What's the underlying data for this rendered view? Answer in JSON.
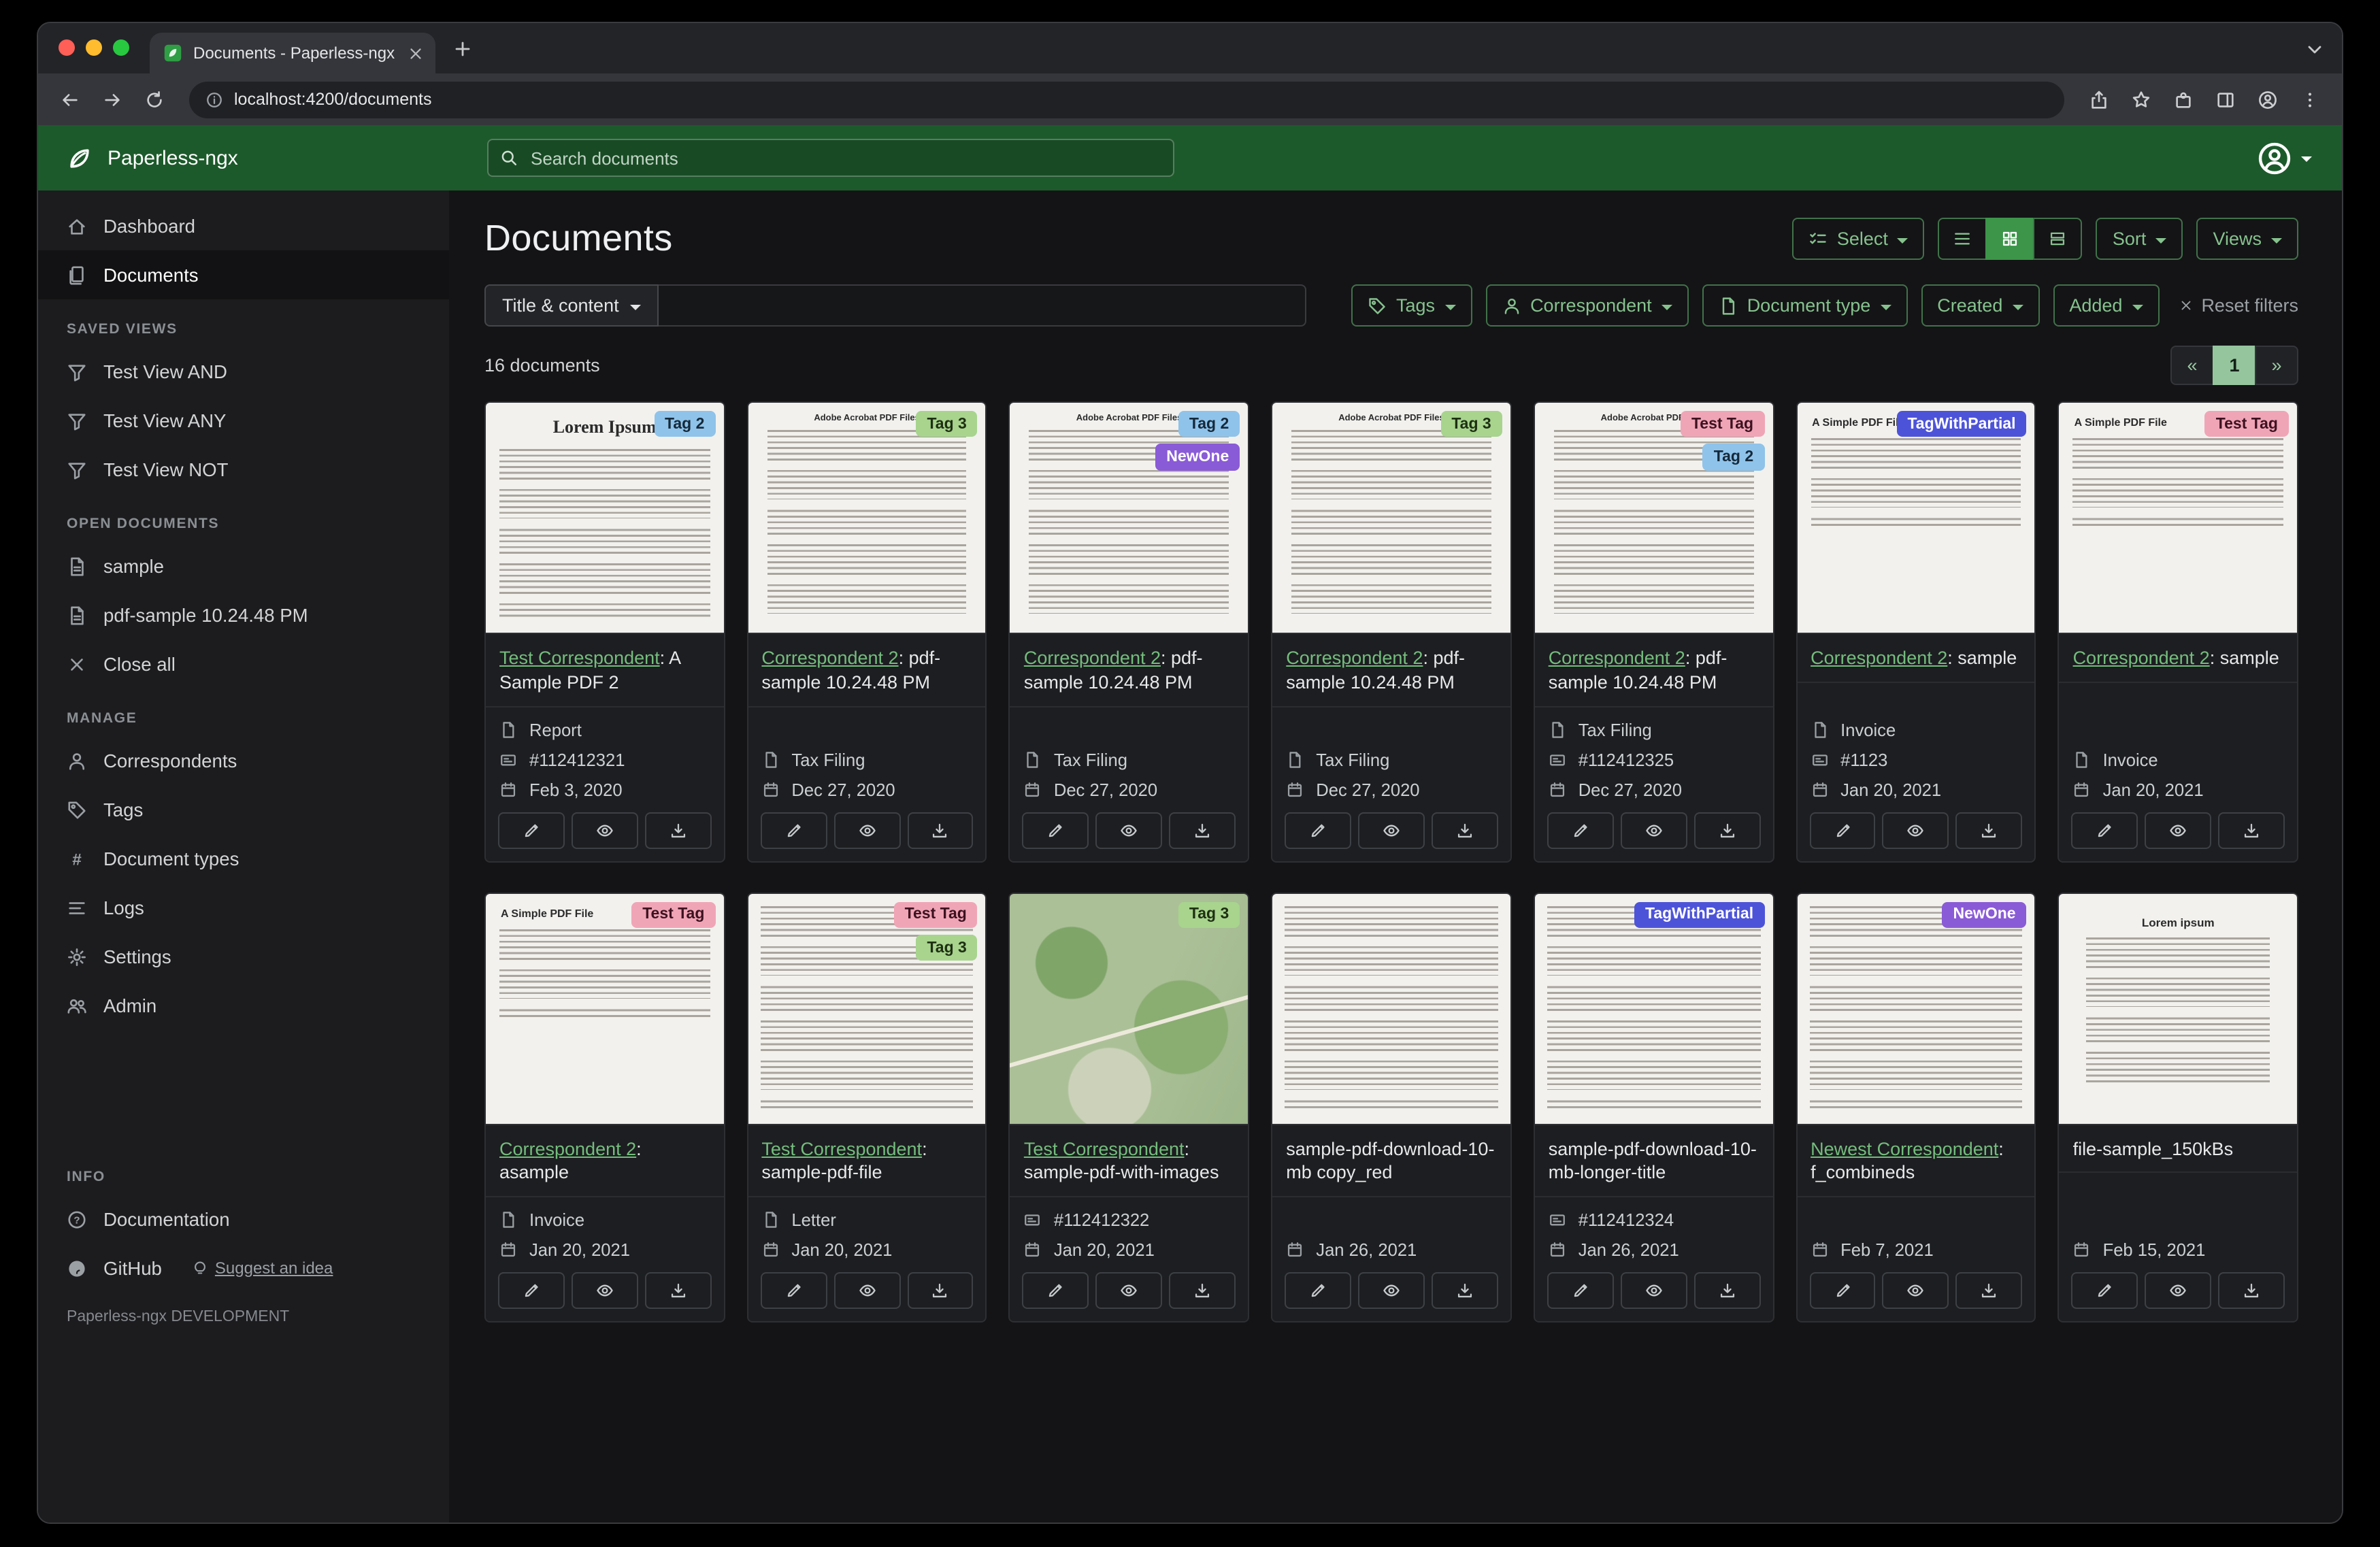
{
  "theme": {
    "accent": "#86c28e",
    "accent-border": "#41724a",
    "active-green": "#3c9549",
    "header-green": "#1d5a2b",
    "link-green": "#74bd7d",
    "page-bg": "#141416",
    "sidebar-bg": "#1c1c1f",
    "card-bg": "#1d1e21"
  },
  "browser": {
    "tab_title": "Documents - Paperless-ngx",
    "url": "localhost:4200/documents"
  },
  "header": {
    "brand": "Paperless-ngx",
    "search_placeholder": "Search documents"
  },
  "sidebar": {
    "dashboard": "Dashboard",
    "documents": "Documents",
    "saved_views_header": "SAVED VIEWS",
    "view_and": "Test View AND",
    "view_any": "Test View ANY",
    "view_not": "Test View NOT",
    "open_documents_header": "OPEN DOCUMENTS",
    "open_doc_1": "sample",
    "open_doc_2": "pdf-sample 10.24.48 PM",
    "close_all": "Close all",
    "manage_header": "MANAGE",
    "correspondents": "Correspondents",
    "tags": "Tags",
    "document_types": "Document types",
    "logs": "Logs",
    "settings": "Settings",
    "admin": "Admin",
    "info_header": "INFO",
    "documentation": "Documentation",
    "github": "GitHub",
    "suggest": "Suggest an idea",
    "footer": "Paperless-ngx DEVELOPMENT"
  },
  "toolbar": {
    "title": "Documents",
    "select_label": "Select",
    "sort_label": "Sort",
    "views_label": "Views"
  },
  "filters": {
    "field_label": "Title & content",
    "query_value": "",
    "tags_label": "Tags",
    "correspondent_label": "Correspondent",
    "document_type_label": "Document type",
    "created_label": "Created",
    "added_label": "Added",
    "reset_label": "Reset filters"
  },
  "results": {
    "count_label": "16 documents",
    "prev": "«",
    "page": "1",
    "next": "»"
  },
  "cards": [
    {
      "correspondent": "Test Correspondent",
      "title_rest": ": A Sample PDF 2",
      "type": "Report",
      "asn": "#112412321",
      "date": "Feb 3, 2020",
      "thumb": "lorem",
      "thumb_heading": "Lorem Ipsum",
      "tags": [
        {
          "label": "Tag 2",
          "bg": "#8fc3ea",
          "fg": "#15293a"
        }
      ]
    },
    {
      "correspondent": "Correspondent 2",
      "title_rest": ": pdf-sample 10.24.48 PM",
      "type": "Tax Filing",
      "asn": "",
      "date": "Dec 27, 2020",
      "thumb": "acrobat",
      "thumb_heading": "Adobe Acrobat PDF Files",
      "tags": [
        {
          "label": "Tag 3",
          "bg": "#a8d48e",
          "fg": "#1e2f12"
        }
      ]
    },
    {
      "correspondent": "Correspondent 2",
      "title_rest": ": pdf-sample 10.24.48 PM",
      "type": "Tax Filing",
      "asn": "",
      "date": "Dec 27, 2020",
      "thumb": "acrobat",
      "thumb_heading": "Adobe Acrobat PDF Files",
      "tags": [
        {
          "label": "Tag 2",
          "bg": "#8fc3ea",
          "fg": "#15293a"
        },
        {
          "label": "NewOne",
          "bg": "#8a5bd6",
          "fg": "#ffffff"
        }
      ]
    },
    {
      "correspondent": "Correspondent 2",
      "title_rest": ": pdf-sample 10.24.48 PM",
      "type": "Tax Filing",
      "asn": "",
      "date": "Dec 27, 2020",
      "thumb": "acrobat",
      "thumb_heading": "Adobe Acrobat PDF Files",
      "tags": [
        {
          "label": "Tag 3",
          "bg": "#a8d48e",
          "fg": "#1e2f12"
        }
      ]
    },
    {
      "correspondent": "Correspondent 2",
      "title_rest": ": pdf-sample 10.24.48 PM",
      "type": "Tax Filing",
      "asn": "#112412325",
      "date": "Dec 27, 2020",
      "thumb": "acrobat",
      "thumb_heading": "Adobe Acrobat PDF Files",
      "tags": [
        {
          "label": "Test Tag",
          "bg": "#f0a5b6",
          "fg": "#3c1220"
        },
        {
          "label": "Tag 2",
          "bg": "#8fc3ea",
          "fg": "#15293a"
        }
      ]
    },
    {
      "correspondent": "Correspondent 2",
      "title_rest": ": sample",
      "type": "Invoice",
      "asn": "#1123",
      "date": "Jan 20, 2021",
      "thumb": "simple",
      "thumb_heading": "A Simple PDF File",
      "tags": [
        {
          "label": "TagWithPartial",
          "bg": "#4d53d8",
          "fg": "#ffffff"
        }
      ]
    },
    {
      "correspondent": "Correspondent 2",
      "title_rest": ": sample",
      "type": "Invoice",
      "asn": "",
      "date": "Jan 20, 2021",
      "thumb": "simple",
      "thumb_heading": "A Simple PDF File",
      "tags": [
        {
          "label": "Test Tag",
          "bg": "#f0a5b6",
          "fg": "#3c1220"
        }
      ]
    },
    {
      "correspondent": "Correspondent 2",
      "title_rest": ": asample",
      "type": "Invoice",
      "asn": "",
      "date": "Jan 20, 2021",
      "thumb": "simple",
      "thumb_heading": "A Simple PDF File",
      "tags": [
        {
          "label": "Test Tag",
          "bg": "#f0a5b6",
          "fg": "#3c1220"
        }
      ]
    },
    {
      "correspondent": "Test Correspondent",
      "title_rest": ": sample-pdf-file",
      "type": "Letter",
      "asn": "",
      "date": "Jan 20, 2021",
      "thumb": "text",
      "thumb_heading": "",
      "tags": [
        {
          "label": "Test Tag",
          "bg": "#f0a5b6",
          "fg": "#3c1220"
        },
        {
          "label": "Tag 3",
          "bg": "#a8d48e",
          "fg": "#1e2f12"
        }
      ]
    },
    {
      "correspondent": "Test Correspondent",
      "title_rest": ": sample-pdf-with-images",
      "type": "",
      "asn": "#112412322",
      "date": "Jan 20, 2021",
      "thumb": "map",
      "thumb_heading": "",
      "tags": [
        {
          "label": "Tag 3",
          "bg": "#a8d48e",
          "fg": "#1e2f12"
        }
      ]
    },
    {
      "correspondent": "",
      "title_rest": "sample-pdf-download-10-mb copy_red",
      "type": "",
      "asn": "",
      "date": "Jan 26, 2021",
      "thumb": "text",
      "thumb_heading": "",
      "tags": []
    },
    {
      "correspondent": "",
      "title_rest": "sample-pdf-download-10-mb-longer-title",
      "type": "",
      "asn": "#112412324",
      "date": "Jan 26, 2021",
      "thumb": "text",
      "thumb_heading": "",
      "tags": [
        {
          "label": "TagWithPartial",
          "bg": "#4d53d8",
          "fg": "#ffffff"
        }
      ]
    },
    {
      "correspondent": "Newest Correspondent",
      "title_rest": ": f_combineds",
      "type": "",
      "asn": "",
      "date": "Feb 7, 2021",
      "thumb": "text",
      "thumb_heading": "",
      "tags": [
        {
          "label": "NewOne",
          "bg": "#8a5bd6",
          "fg": "#ffffff"
        }
      ]
    },
    {
      "correspondent": "",
      "title_rest": "file-sample_150kBs",
      "type": "",
      "asn": "",
      "date": "Feb 15, 2021",
      "thumb": "lorem2",
      "thumb_heading": "Lorem ipsum",
      "tags": []
    }
  ]
}
